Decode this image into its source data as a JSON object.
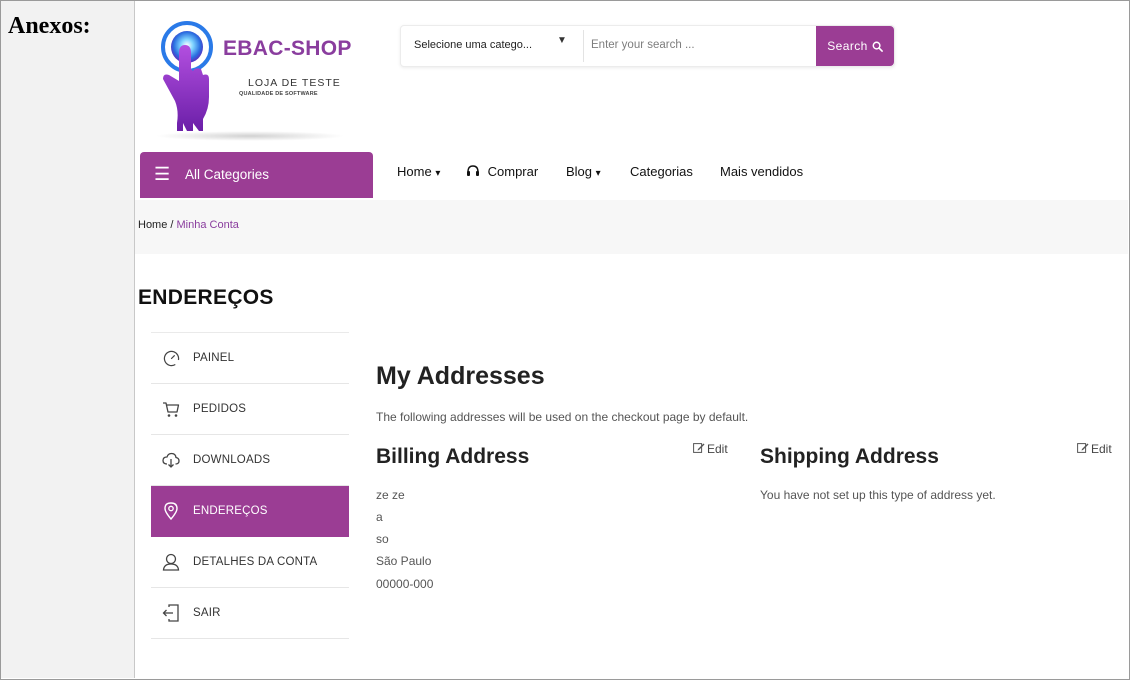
{
  "annex_label": "Anexos:",
  "colors": {
    "accent": "#9b3d94",
    "brand_text": "#8a3d9e"
  },
  "logo": {
    "brand": "EBAC-SHOP",
    "subtitle": "LOJA DE TESTE",
    "tagline": "QUALIDADE DE SOFTWARE"
  },
  "search": {
    "category_label": "Selecione uma catego...",
    "placeholder": "Enter your search ...",
    "button_label": "Search"
  },
  "nav": {
    "all_categories": "All Categories",
    "items": [
      "Home",
      "Comprar",
      "Blog",
      "Categorias",
      "Mais vendidos"
    ]
  },
  "breadcrumb": {
    "home": "Home",
    "separator": " / ",
    "current": "Minha Conta"
  },
  "page_title": "ENDEREÇOS",
  "account_menu": [
    {
      "label": "PAINEL",
      "icon": "dashboard-icon"
    },
    {
      "label": "PEDIDOS",
      "icon": "cart-icon"
    },
    {
      "label": "DOWNLOADS",
      "icon": "cloud-download-icon"
    },
    {
      "label": "ENDEREÇOS",
      "icon": "location-pin-icon",
      "active": true
    },
    {
      "label": "DETALHES DA CONTA",
      "icon": "user-icon"
    },
    {
      "label": "SAIR",
      "icon": "logout-icon"
    }
  ],
  "main": {
    "heading": "My Addresses",
    "intro": "The following addresses will be used on the checkout page by default.",
    "billing": {
      "title": "Billing Address",
      "edit_label": "Edit",
      "lines": [
        "ze ze",
        "a",
        "so",
        "São Paulo",
        "00000-000"
      ]
    },
    "shipping": {
      "title": "Shipping Address",
      "edit_label": "Edit",
      "empty_message": "You have not set up this type of address yet."
    }
  }
}
